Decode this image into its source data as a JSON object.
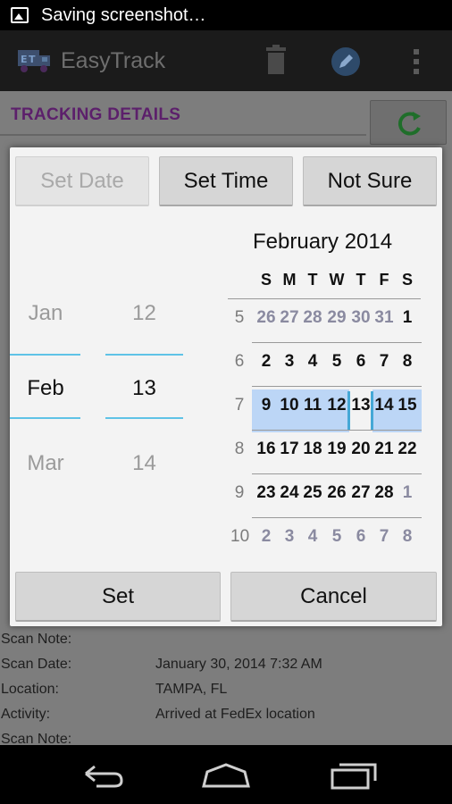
{
  "status_bar": {
    "notification_text": "Saving screenshot…"
  },
  "app_bar": {
    "title": "EasyTrack"
  },
  "background": {
    "section_header": "TRACKING DETAILS",
    "scan_rows": [
      {
        "label": "Scan Note:",
        "value": ""
      },
      {
        "label": "Scan Date:",
        "value": "January 30, 2014 7:32 AM"
      },
      {
        "label": "Location:",
        "value": "TAMPA, FL"
      },
      {
        "label": "Activity:",
        "value": "Arrived at FedEx location"
      },
      {
        "label": "Scan Note:",
        "value": ""
      }
    ]
  },
  "dialog": {
    "buttons": {
      "set_date": "Set Date",
      "set_time": "Set Time",
      "not_sure": "Not Sure",
      "set": "Set",
      "cancel": "Cancel"
    },
    "month_picker": {
      "prev": "Jan",
      "selected": "Feb",
      "next": "Mar"
    },
    "day_picker": {
      "prev": "12",
      "selected": "13",
      "next": "14"
    },
    "calendar": {
      "title": "February 2014",
      "weekdays": [
        "S",
        "M",
        "T",
        "W",
        "T",
        "F",
        "S"
      ],
      "weeks": [
        {
          "num": "5",
          "days": [
            "26",
            "27",
            "28",
            "29",
            "30",
            "31",
            "1"
          ]
        },
        {
          "num": "6",
          "days": [
            "2",
            "3",
            "4",
            "5",
            "6",
            "7",
            "8"
          ]
        },
        {
          "num": "7",
          "days": [
            "9",
            "10",
            "11",
            "12",
            "13",
            "14",
            "15"
          ]
        },
        {
          "num": "8",
          "days": [
            "16",
            "17",
            "18",
            "19",
            "20",
            "21",
            "22"
          ]
        },
        {
          "num": "9",
          "days": [
            "23",
            "24",
            "25",
            "26",
            "27",
            "28",
            "1"
          ]
        },
        {
          "num": "10",
          "days": [
            "2",
            "3",
            "4",
            "5",
            "6",
            "7",
            "8"
          ]
        }
      ],
      "selected_day": "13",
      "accent_color": "#45a8d6",
      "selection_color": "#bcd6f6"
    }
  }
}
